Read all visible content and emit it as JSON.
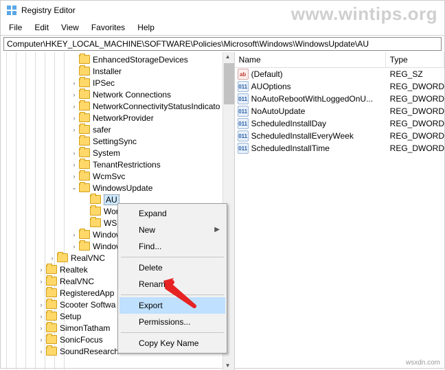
{
  "window": {
    "title": "Registry Editor"
  },
  "watermark": "www.wintips.org",
  "footer": "wsxdn.com",
  "menubar": [
    "File",
    "Edit",
    "View",
    "Favorites",
    "Help"
  ],
  "address": {
    "path": "Computer\\HKEY_LOCAL_MACHINE\\SOFTWARE\\Policies\\Microsoft\\Windows\\WindowsUpdate\\AU"
  },
  "tree": {
    "items": [
      {
        "i": 0,
        "label": "EnhancedStorageDevices",
        "t": ""
      },
      {
        "i": 1,
        "label": "Installer",
        "t": ""
      },
      {
        "i": 2,
        "label": "IPSec",
        "t": "›"
      },
      {
        "i": 3,
        "label": "Network Connections",
        "t": "›"
      },
      {
        "i": 4,
        "label": "NetworkConnectivityStatusIndicato",
        "t": "›"
      },
      {
        "i": 5,
        "label": "NetworkProvider",
        "t": "›"
      },
      {
        "i": 6,
        "label": "safer",
        "t": "›"
      },
      {
        "i": 7,
        "label": "SettingSync",
        "t": ""
      },
      {
        "i": 8,
        "label": "System",
        "t": "›"
      },
      {
        "i": 9,
        "label": "TenantRestrictions",
        "t": "›"
      },
      {
        "i": 10,
        "label": "WcmSvc",
        "t": "›"
      },
      {
        "i": 11,
        "label": "WindowsUpdate",
        "t": "v"
      },
      {
        "i": 12,
        "label": "AU",
        "t": "",
        "sel": true,
        "indent": 1
      },
      {
        "i": 13,
        "label": "Work",
        "t": "",
        "indent": 1
      },
      {
        "i": 14,
        "label": "WSDA",
        "t": "",
        "indent": 1
      },
      {
        "i": 15,
        "label": "Window",
        "t": "›"
      },
      {
        "i": 16,
        "label": "Window",
        "t": "›"
      },
      {
        "i": 17,
        "label": "RealVNC",
        "t": "›",
        "indent": -2
      },
      {
        "i": 18,
        "label": "Realtek",
        "t": "›",
        "indent": -3
      },
      {
        "i": 19,
        "label": "RealVNC",
        "t": "›",
        "indent": -3
      },
      {
        "i": 20,
        "label": "RegisteredApp",
        "t": "",
        "indent": -3
      },
      {
        "i": 21,
        "label": "Scooter Softwa",
        "t": "›",
        "indent": -3
      },
      {
        "i": 22,
        "label": "Setup",
        "t": "›",
        "indent": -3
      },
      {
        "i": 23,
        "label": "SimonTatham",
        "t": "›",
        "indent": -3
      },
      {
        "i": 24,
        "label": "SonicFocus",
        "t": "›",
        "indent": -3
      },
      {
        "i": 25,
        "label": "SoundResearch",
        "t": "›",
        "indent": -3
      }
    ]
  },
  "list": {
    "columns": {
      "name": "Name",
      "type": "Type"
    },
    "rows": [
      {
        "icon": "sz",
        "name": "(Default)",
        "type": "REG_SZ"
      },
      {
        "icon": "dw",
        "name": "AUOptions",
        "type": "REG_DWORD"
      },
      {
        "icon": "dw",
        "name": "NoAutoRebootWithLoggedOnU...",
        "type": "REG_DWORD"
      },
      {
        "icon": "dw",
        "name": "NoAutoUpdate",
        "type": "REG_DWORD"
      },
      {
        "icon": "dw",
        "name": "ScheduledInstallDay",
        "type": "REG_DWORD"
      },
      {
        "icon": "dw",
        "name": "ScheduledInstallEveryWeek",
        "type": "REG_DWORD"
      },
      {
        "icon": "dw",
        "name": "ScheduledInstallTime",
        "type": "REG_DWORD"
      }
    ]
  },
  "context_menu": {
    "items": [
      {
        "label": "Expand"
      },
      {
        "label": "New",
        "sub": true
      },
      {
        "label": "Find..."
      },
      {
        "sep": true
      },
      {
        "label": "Delete"
      },
      {
        "label": "Rename"
      },
      {
        "sep": true
      },
      {
        "label": "Export",
        "hl": true
      },
      {
        "label": "Permissions..."
      },
      {
        "sep": true
      },
      {
        "label": "Copy Key Name"
      }
    ]
  }
}
